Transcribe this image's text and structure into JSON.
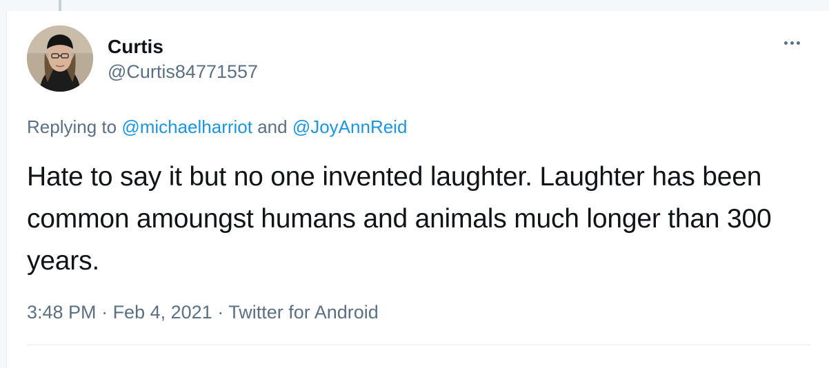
{
  "tweet": {
    "author": {
      "display_name": "Curtis",
      "handle": "@Curtis84771557"
    },
    "more_icon": "more-horizontal-icon",
    "replying": {
      "prefix": "Replying to ",
      "mentions": [
        "@michaelharriot",
        "@JoyAnnReid"
      ],
      "conjunction": " and "
    },
    "text": "Hate to say it but no one invented laughter. Laughter has been common amoungst humans and animals much longer than 300 years.",
    "meta": {
      "time": "3:48 PM",
      "separator": " · ",
      "date": "Feb 4, 2021",
      "source": "Twitter for Android"
    }
  },
  "colors": {
    "text": "#0f1419",
    "secondary": "#5b7083",
    "link": "#1b95e0",
    "border": "#e6ecf0"
  }
}
